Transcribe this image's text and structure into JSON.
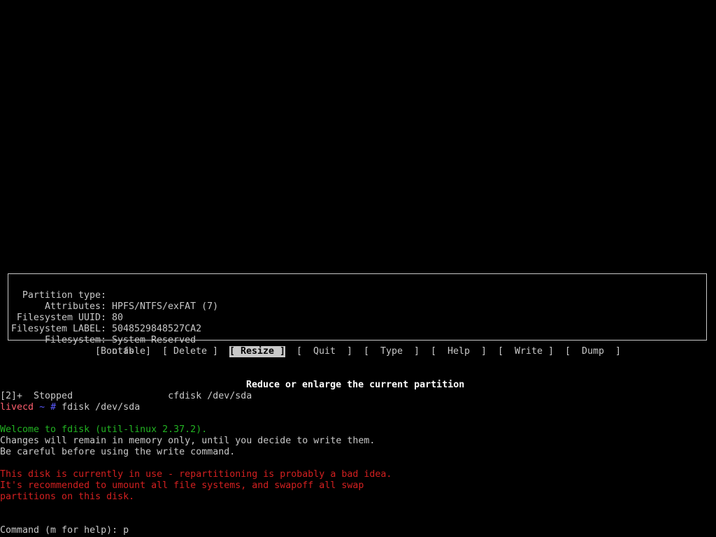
{
  "partition_info": [
    {
      "label": "Partition type:",
      "value": "HPFS/NTFS/exFAT (7)"
    },
    {
      "label": "Attributes:",
      "value": "80"
    },
    {
      "label": "Filesystem UUID:",
      "value": "5048529848527CA2"
    },
    {
      "label": "Filesystem LABEL:",
      "value": "System Reserved"
    },
    {
      "label": "Filesystem:",
      "value": "ntfs"
    }
  ],
  "menu": [
    {
      "label": "[Bootable]",
      "selected": false
    },
    {
      "label": "[ Delete ]",
      "selected": false
    },
    {
      "label": "[ Resize ]",
      "selected": true
    },
    {
      "label": "[  Quit  ]",
      "selected": false
    },
    {
      "label": "[  Type  ]",
      "selected": false
    },
    {
      "label": "[  Help  ]",
      "selected": false
    },
    {
      "label": "[  Write ]",
      "selected": false
    },
    {
      "label": "[  Dump  ]",
      "selected": false
    }
  ],
  "menu_help": "Reduce or enlarge the current partition",
  "terminal": {
    "job_line": "[2]+  Stopped                 cfdisk /dev/sda",
    "prompt_host": "livecd",
    "prompt_dir": "~",
    "prompt_symbol": "#",
    "prompt_command": "fdisk /dev/sda",
    "welcome": "Welcome to fdisk (util-linux 2.37.2).",
    "changes_line": "Changes will remain in memory only, until you decide to write them.",
    "careful_line": "Be careful before using the write command.",
    "warning_1": "This disk is currently in use - repartitioning is probably a bad idea.",
    "warning_2": "It's recommended to umount all file systems, and swapoff all swap",
    "warning_3": "partitions on this disk.",
    "command_prompt": "Command (m for help): p"
  },
  "colors": {
    "background": "#000000",
    "text": "#c8c8c8",
    "green": "#22b322",
    "red": "#d42020",
    "host": "#ff5f6e",
    "prompt": "#5a5aff"
  }
}
